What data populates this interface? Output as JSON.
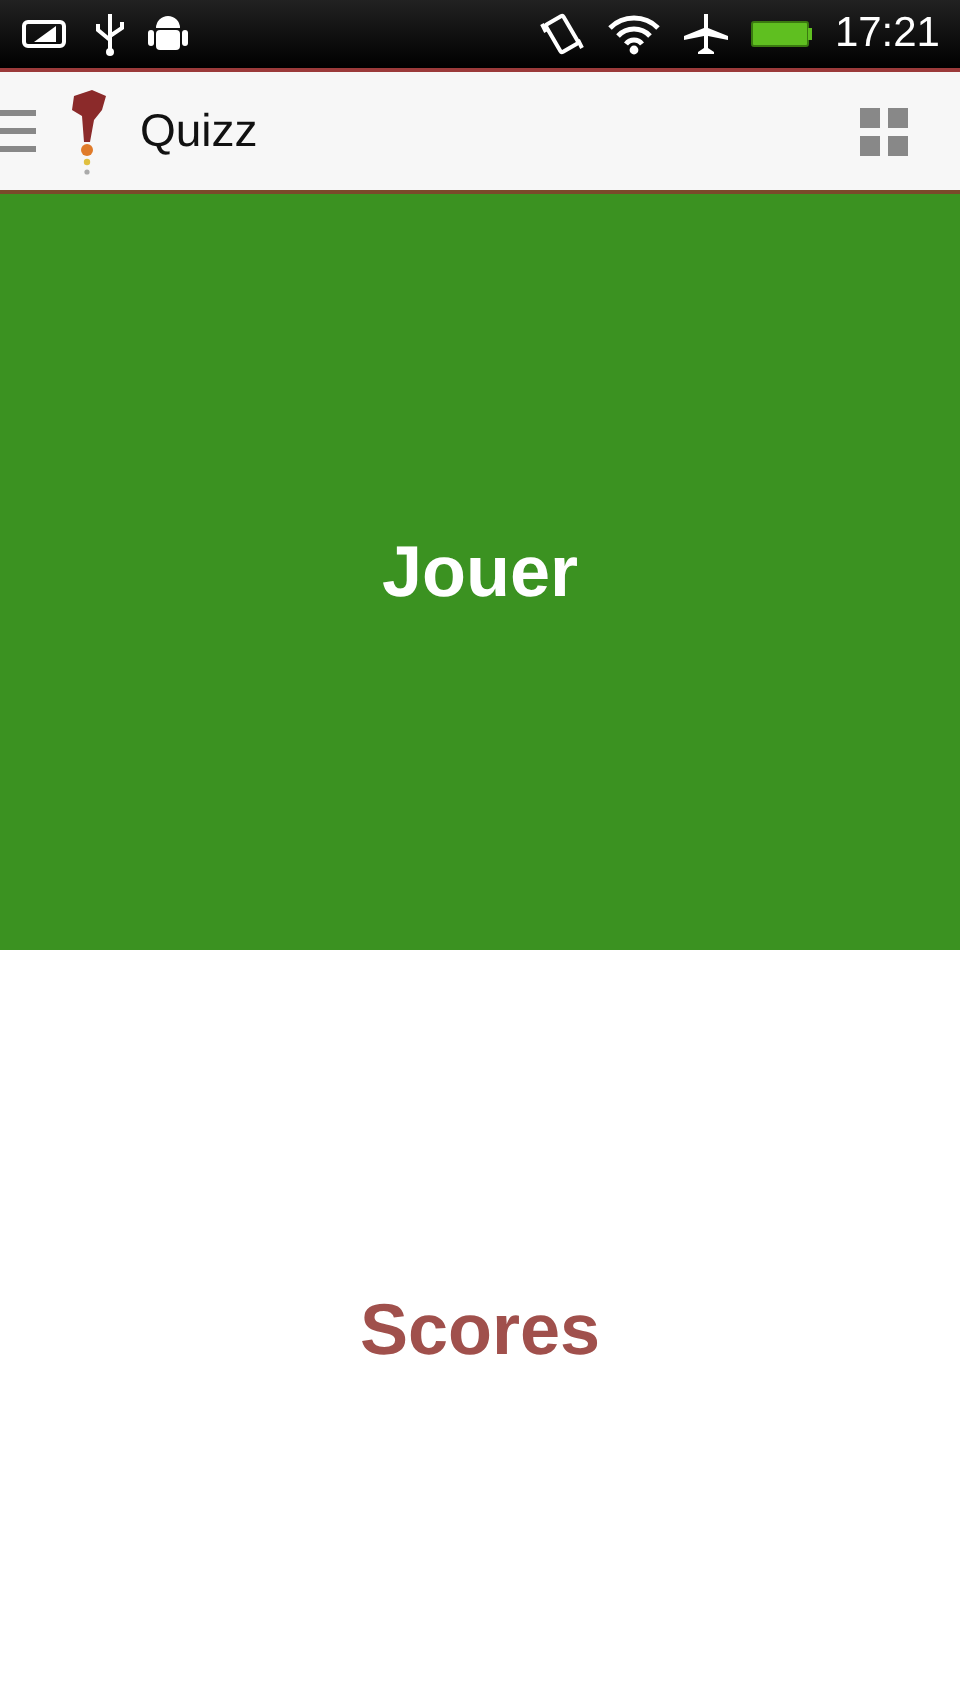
{
  "status_bar": {
    "time": "17:21"
  },
  "app_bar": {
    "title": "Quizz"
  },
  "tiles": [
    {
      "label": "Jouer",
      "kind": "filled"
    },
    {
      "label": "Scores",
      "kind": "plain"
    }
  ]
}
